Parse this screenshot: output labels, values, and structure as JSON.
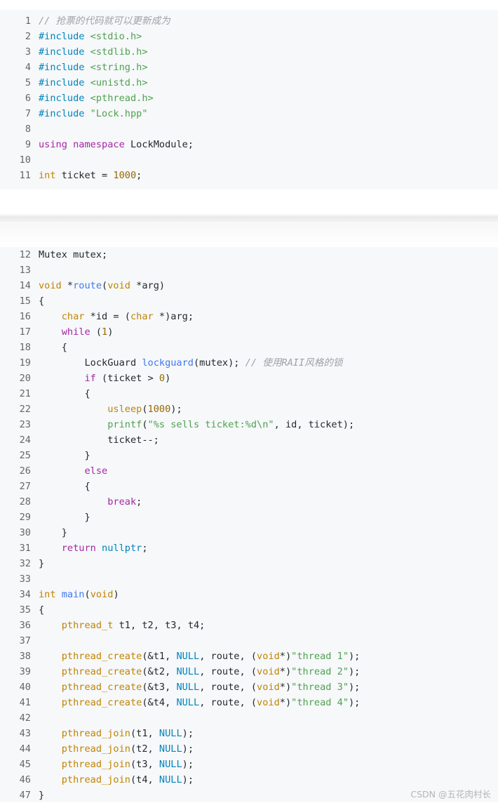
{
  "blocks": [
    {
      "lines": [
        {
          "n": "1",
          "toks": [
            [
              "// 抢票的代码就可以更新成为",
              "com"
            ]
          ]
        },
        {
          "n": "2",
          "toks": [
            [
              "#include ",
              "const"
            ],
            [
              "<stdio.h>",
              "str"
            ]
          ]
        },
        {
          "n": "3",
          "toks": [
            [
              "#include ",
              "const"
            ],
            [
              "<stdlib.h>",
              "str"
            ]
          ]
        },
        {
          "n": "4",
          "toks": [
            [
              "#include ",
              "const"
            ],
            [
              "<string.h>",
              "str"
            ]
          ]
        },
        {
          "n": "5",
          "toks": [
            [
              "#include ",
              "const"
            ],
            [
              "<unistd.h>",
              "str"
            ]
          ]
        },
        {
          "n": "6",
          "toks": [
            [
              "#include ",
              "const"
            ],
            [
              "<pthread.h>",
              "str"
            ]
          ]
        },
        {
          "n": "7",
          "toks": [
            [
              "#include ",
              "const"
            ],
            [
              "\"Lock.hpp\"",
              "str"
            ]
          ]
        },
        {
          "n": "8",
          "toks": []
        },
        {
          "n": "9",
          "toks": [
            [
              "using",
              "kw"
            ],
            [
              " ",
              "plain"
            ],
            [
              "namespace",
              "kw"
            ],
            [
              " LockModule;",
              "plain"
            ]
          ]
        },
        {
          "n": "10",
          "toks": []
        },
        {
          "n": "11",
          "toks": [
            [
              "int",
              "type"
            ],
            [
              " ticket = ",
              "plain"
            ],
            [
              "1000",
              "num"
            ],
            [
              ";",
              "plain"
            ]
          ]
        }
      ]
    },
    {
      "lines": [
        {
          "n": "12",
          "toks": [
            [
              "Mutex mutex;",
              "plain"
            ]
          ]
        },
        {
          "n": "13",
          "toks": []
        },
        {
          "n": "14",
          "toks": [
            [
              "void",
              "type"
            ],
            [
              " *",
              "plain"
            ],
            [
              "route",
              "fn"
            ],
            [
              "(",
              "plain"
            ],
            [
              "void",
              "type"
            ],
            [
              " *arg)",
              "plain"
            ]
          ]
        },
        {
          "n": "15",
          "toks": [
            [
              "{",
              "plain"
            ]
          ]
        },
        {
          "n": "16",
          "toks": [
            [
              "    ",
              "plain"
            ],
            [
              "char",
              "type"
            ],
            [
              " *id = (",
              "plain"
            ],
            [
              "char",
              "type"
            ],
            [
              " *)arg;",
              "plain"
            ]
          ]
        },
        {
          "n": "17",
          "toks": [
            [
              "    ",
              "plain"
            ],
            [
              "while",
              "kw"
            ],
            [
              " (",
              "plain"
            ],
            [
              "1",
              "num"
            ],
            [
              ")",
              "plain"
            ]
          ]
        },
        {
          "n": "18",
          "toks": [
            [
              "    {",
              "plain"
            ]
          ]
        },
        {
          "n": "19",
          "toks": [
            [
              "        LockGuard ",
              "plain"
            ],
            [
              "lockguard",
              "fn"
            ],
            [
              "(mutex); ",
              "plain"
            ],
            [
              "// 使用RAII风格的锁",
              "com"
            ]
          ]
        },
        {
          "n": "20",
          "toks": [
            [
              "        ",
              "plain"
            ],
            [
              "if",
              "kw"
            ],
            [
              " (ticket > ",
              "plain"
            ],
            [
              "0",
              "num"
            ],
            [
              ")",
              "plain"
            ]
          ]
        },
        {
          "n": "21",
          "toks": [
            [
              "        {",
              "plain"
            ]
          ]
        },
        {
          "n": "22",
          "toks": [
            [
              "            ",
              "plain"
            ],
            [
              "usleep",
              "type"
            ],
            [
              "(",
              "plain"
            ],
            [
              "1000",
              "num"
            ],
            [
              ");",
              "plain"
            ]
          ]
        },
        {
          "n": "23",
          "toks": [
            [
              "            ",
              "plain"
            ],
            [
              "printf",
              "str"
            ],
            [
              "(",
              "plain"
            ],
            [
              "\"%s sells ticket:%d\\n\"",
              "str"
            ],
            [
              ", id, ticket);",
              "plain"
            ]
          ]
        },
        {
          "n": "24",
          "toks": [
            [
              "            ticket--;",
              "plain"
            ]
          ]
        },
        {
          "n": "25",
          "toks": [
            [
              "        }",
              "plain"
            ]
          ]
        },
        {
          "n": "26",
          "toks": [
            [
              "        ",
              "plain"
            ],
            [
              "else",
              "kw"
            ]
          ]
        },
        {
          "n": "27",
          "toks": [
            [
              "        {",
              "plain"
            ]
          ]
        },
        {
          "n": "28",
          "toks": [
            [
              "            ",
              "plain"
            ],
            [
              "break",
              "kw"
            ],
            [
              ";",
              "plain"
            ]
          ]
        },
        {
          "n": "29",
          "toks": [
            [
              "        }",
              "plain"
            ]
          ]
        },
        {
          "n": "30",
          "toks": [
            [
              "    }",
              "plain"
            ]
          ]
        },
        {
          "n": "31",
          "toks": [
            [
              "    ",
              "plain"
            ],
            [
              "return",
              "kw"
            ],
            [
              " ",
              "plain"
            ],
            [
              "nullptr",
              "const"
            ],
            [
              ";",
              "plain"
            ]
          ]
        },
        {
          "n": "32",
          "toks": [
            [
              "}",
              "plain"
            ]
          ]
        },
        {
          "n": "33",
          "toks": []
        },
        {
          "n": "34",
          "toks": [
            [
              "int",
              "type"
            ],
            [
              " ",
              "plain"
            ],
            [
              "main",
              "fn"
            ],
            [
              "(",
              "plain"
            ],
            [
              "void",
              "type"
            ],
            [
              ")",
              "plain"
            ]
          ]
        },
        {
          "n": "35",
          "toks": [
            [
              "{",
              "plain"
            ]
          ]
        },
        {
          "n": "36",
          "toks": [
            [
              "    ",
              "plain"
            ],
            [
              "pthread_t",
              "type"
            ],
            [
              " t1, t2, t3, t4;",
              "plain"
            ]
          ]
        },
        {
          "n": "37",
          "toks": []
        },
        {
          "n": "38",
          "toks": [
            [
              "    ",
              "plain"
            ],
            [
              "pthread_create",
              "type"
            ],
            [
              "(&t1, ",
              "plain"
            ],
            [
              "NULL",
              "const"
            ],
            [
              ", route, (",
              "plain"
            ],
            [
              "void",
              "type"
            ],
            [
              "*)",
              "plain"
            ],
            [
              "\"thread 1\"",
              "str"
            ],
            [
              ");",
              "plain"
            ]
          ]
        },
        {
          "n": "39",
          "toks": [
            [
              "    ",
              "plain"
            ],
            [
              "pthread_create",
              "type"
            ],
            [
              "(&t2, ",
              "plain"
            ],
            [
              "NULL",
              "const"
            ],
            [
              ", route, (",
              "plain"
            ],
            [
              "void",
              "type"
            ],
            [
              "*)",
              "plain"
            ],
            [
              "\"thread 2\"",
              "str"
            ],
            [
              ");",
              "plain"
            ]
          ]
        },
        {
          "n": "40",
          "toks": [
            [
              "    ",
              "plain"
            ],
            [
              "pthread_create",
              "type"
            ],
            [
              "(&t3, ",
              "plain"
            ],
            [
              "NULL",
              "const"
            ],
            [
              ", route, (",
              "plain"
            ],
            [
              "void",
              "type"
            ],
            [
              "*)",
              "plain"
            ],
            [
              "\"thread 3\"",
              "str"
            ],
            [
              ");",
              "plain"
            ]
          ]
        },
        {
          "n": "41",
          "toks": [
            [
              "    ",
              "plain"
            ],
            [
              "pthread_create",
              "type"
            ],
            [
              "(&t4, ",
              "plain"
            ],
            [
              "NULL",
              "const"
            ],
            [
              ", route, (",
              "plain"
            ],
            [
              "void",
              "type"
            ],
            [
              "*)",
              "plain"
            ],
            [
              "\"thread 4\"",
              "str"
            ],
            [
              ");",
              "plain"
            ]
          ]
        },
        {
          "n": "42",
          "toks": []
        },
        {
          "n": "43",
          "toks": [
            [
              "    ",
              "plain"
            ],
            [
              "pthread_join",
              "type"
            ],
            [
              "(t1, ",
              "plain"
            ],
            [
              "NULL",
              "const"
            ],
            [
              ");",
              "plain"
            ]
          ]
        },
        {
          "n": "44",
          "toks": [
            [
              "    ",
              "plain"
            ],
            [
              "pthread_join",
              "type"
            ],
            [
              "(t2, ",
              "plain"
            ],
            [
              "NULL",
              "const"
            ],
            [
              ");",
              "plain"
            ]
          ]
        },
        {
          "n": "45",
          "toks": [
            [
              "    ",
              "plain"
            ],
            [
              "pthread_join",
              "type"
            ],
            [
              "(t3, ",
              "plain"
            ],
            [
              "NULL",
              "const"
            ],
            [
              ");",
              "plain"
            ]
          ]
        },
        {
          "n": "46",
          "toks": [
            [
              "    ",
              "plain"
            ],
            [
              "pthread_join",
              "type"
            ],
            [
              "(t4, ",
              "plain"
            ],
            [
              "NULL",
              "const"
            ],
            [
              ");",
              "plain"
            ]
          ]
        },
        {
          "n": "47",
          "toks": [
            [
              "}",
              "plain"
            ]
          ]
        }
      ]
    }
  ],
  "watermark": "CSDN @五花肉村长",
  "colors": {
    "background": "#f6f8fa",
    "keyword": "#a626a4",
    "type": "#c18401",
    "function": "#4078f2",
    "string": "#50a14f",
    "number": "#986801",
    "comment": "#a0a1a7",
    "constant": "#0184bc"
  }
}
